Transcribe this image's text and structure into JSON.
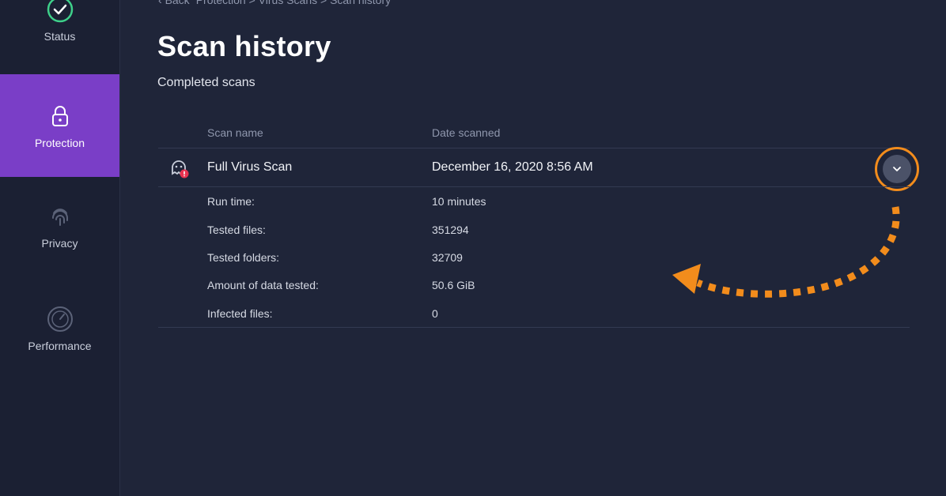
{
  "sidebar": {
    "items": [
      {
        "label": "Status",
        "icon": "check-circle-icon"
      },
      {
        "label": "Protection",
        "icon": "lock-icon",
        "active": true
      },
      {
        "label": "Privacy",
        "icon": "fingerprint-icon"
      },
      {
        "label": "Performance",
        "icon": "gauge-icon"
      }
    ]
  },
  "breadcrumb": {
    "back": "Back",
    "path": "Protection > Virus Scans > Scan history"
  },
  "page": {
    "title": "Scan history",
    "subtitle": "Completed scans"
  },
  "table": {
    "headers": {
      "name": "Scan name",
      "date": "Date scanned"
    },
    "scan": {
      "name": "Full Virus Scan",
      "date": "December 16, 2020 8:56 AM",
      "icon": "scan-alert-icon",
      "details": [
        {
          "label": "Run time:",
          "value": "10 minutes"
        },
        {
          "label": "Tested files:",
          "value": "351294"
        },
        {
          "label": "Tested folders:",
          "value": "32709"
        },
        {
          "label": "Amount of data tested:",
          "value": "50.6 GiB"
        },
        {
          "label": "Infected files:",
          "value": "0"
        }
      ]
    }
  },
  "colors": {
    "background": "#1f2539",
    "sidebar": "#1b2033",
    "active": "#7a3ec7",
    "highlight": "#f28c1c",
    "alert": "#e8324f"
  }
}
